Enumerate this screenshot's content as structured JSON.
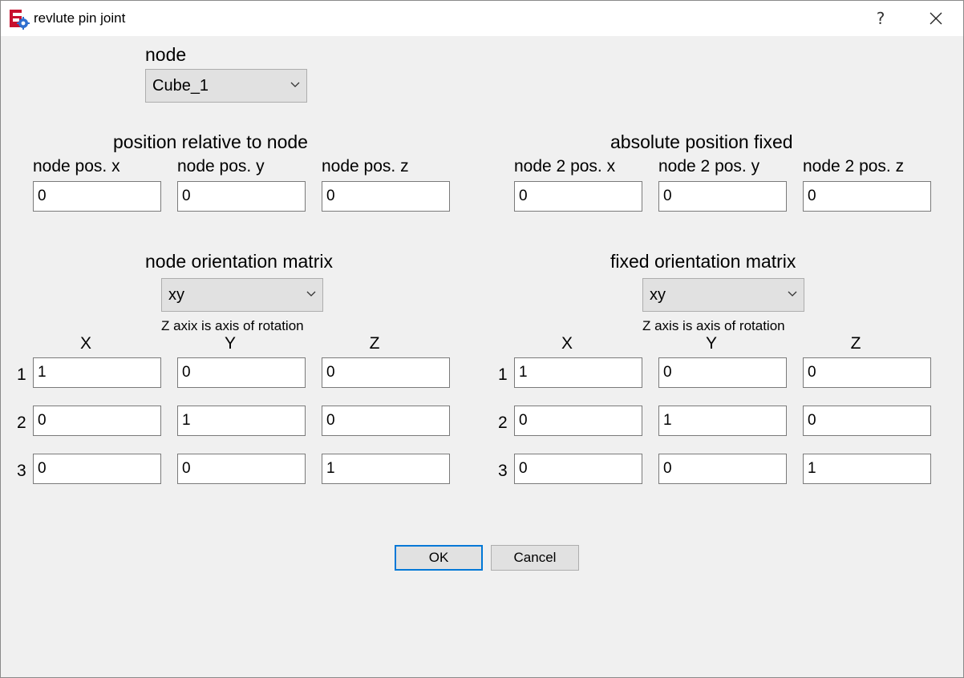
{
  "window": {
    "title": "revlute pin joint",
    "help_label": "?"
  },
  "node": {
    "label": "node",
    "selected": "Cube_1"
  },
  "position_relative": {
    "heading": "position relative to node",
    "labels": [
      "node pos. x",
      "node pos. y",
      "node pos. z"
    ],
    "values": [
      "0",
      "0",
      "0"
    ]
  },
  "absolute_position": {
    "heading": "absolute position fixed",
    "labels": [
      "node 2 pos. x",
      "node 2 pos. y",
      "node 2 pos. z"
    ],
    "values": [
      "0",
      "0",
      "0"
    ]
  },
  "node_orientation": {
    "heading": "node orientation matrix",
    "selected": "xy",
    "note": "Z axix is axis of rotation",
    "columns": [
      "X",
      "Y",
      "Z"
    ],
    "rows": [
      "1",
      "2",
      "3"
    ],
    "matrix": [
      [
        "1",
        "0",
        "0"
      ],
      [
        "0",
        "1",
        "0"
      ],
      [
        "0",
        "0",
        "1"
      ]
    ]
  },
  "fixed_orientation": {
    "heading": "fixed orientation matrix",
    "selected": "xy",
    "note": "Z axis is axis of rotation",
    "columns": [
      "X",
      "Y",
      "Z"
    ],
    "rows": [
      "1",
      "2",
      "3"
    ],
    "matrix": [
      [
        "1",
        "0",
        "0"
      ],
      [
        "0",
        "1",
        "0"
      ],
      [
        "0",
        "0",
        "1"
      ]
    ]
  },
  "buttons": {
    "ok": "OK",
    "cancel": "Cancel"
  },
  "colors": {
    "accent": "#0078d7",
    "dialog_bg": "#f0f0f0"
  }
}
